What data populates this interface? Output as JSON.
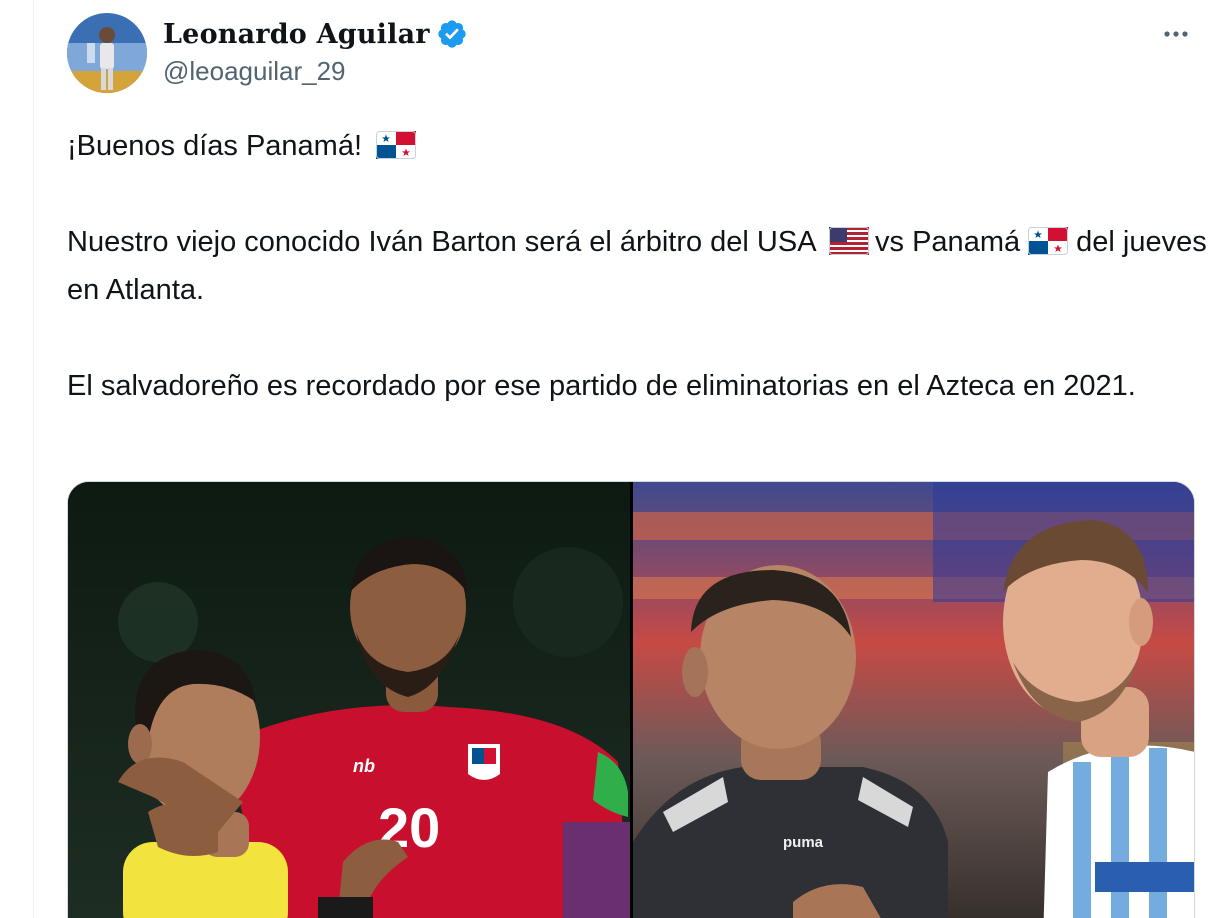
{
  "author": {
    "display_name": "Leonardo Aguilar",
    "handle": "@leoaguilar_29",
    "verified": true,
    "verified_color": "#1d9bf0"
  },
  "more_menu": {
    "label": "···"
  },
  "tweet": {
    "line1": "¡Buenos días Panamá!",
    "line2a": "Nuestro viejo conocido Iván Barton será el árbitro del USA",
    "line2b": "vs Panamá",
    "line2c": "del jueves en Atlanta.",
    "line3": "El salvadoreño es recordado por ese partido de eliminatorias en el Azteca en 2021."
  },
  "flags": {
    "panama": "panama-flag-icon",
    "usa": "usa-flag-icon"
  },
  "media": {
    "left_photo": {
      "jersey_number": "20",
      "jersey_brand": "nb"
    },
    "right_photo": {
      "shirt_brand": "puma"
    }
  },
  "colors": {
    "text": "#0f1419",
    "secondary_text": "#536471",
    "panama_red": "#d21034",
    "panama_blue": "#005293",
    "jersey_red": "#c8102e",
    "referee_yellow": "#f2e43c",
    "argentina_blue": "#74acdf"
  }
}
